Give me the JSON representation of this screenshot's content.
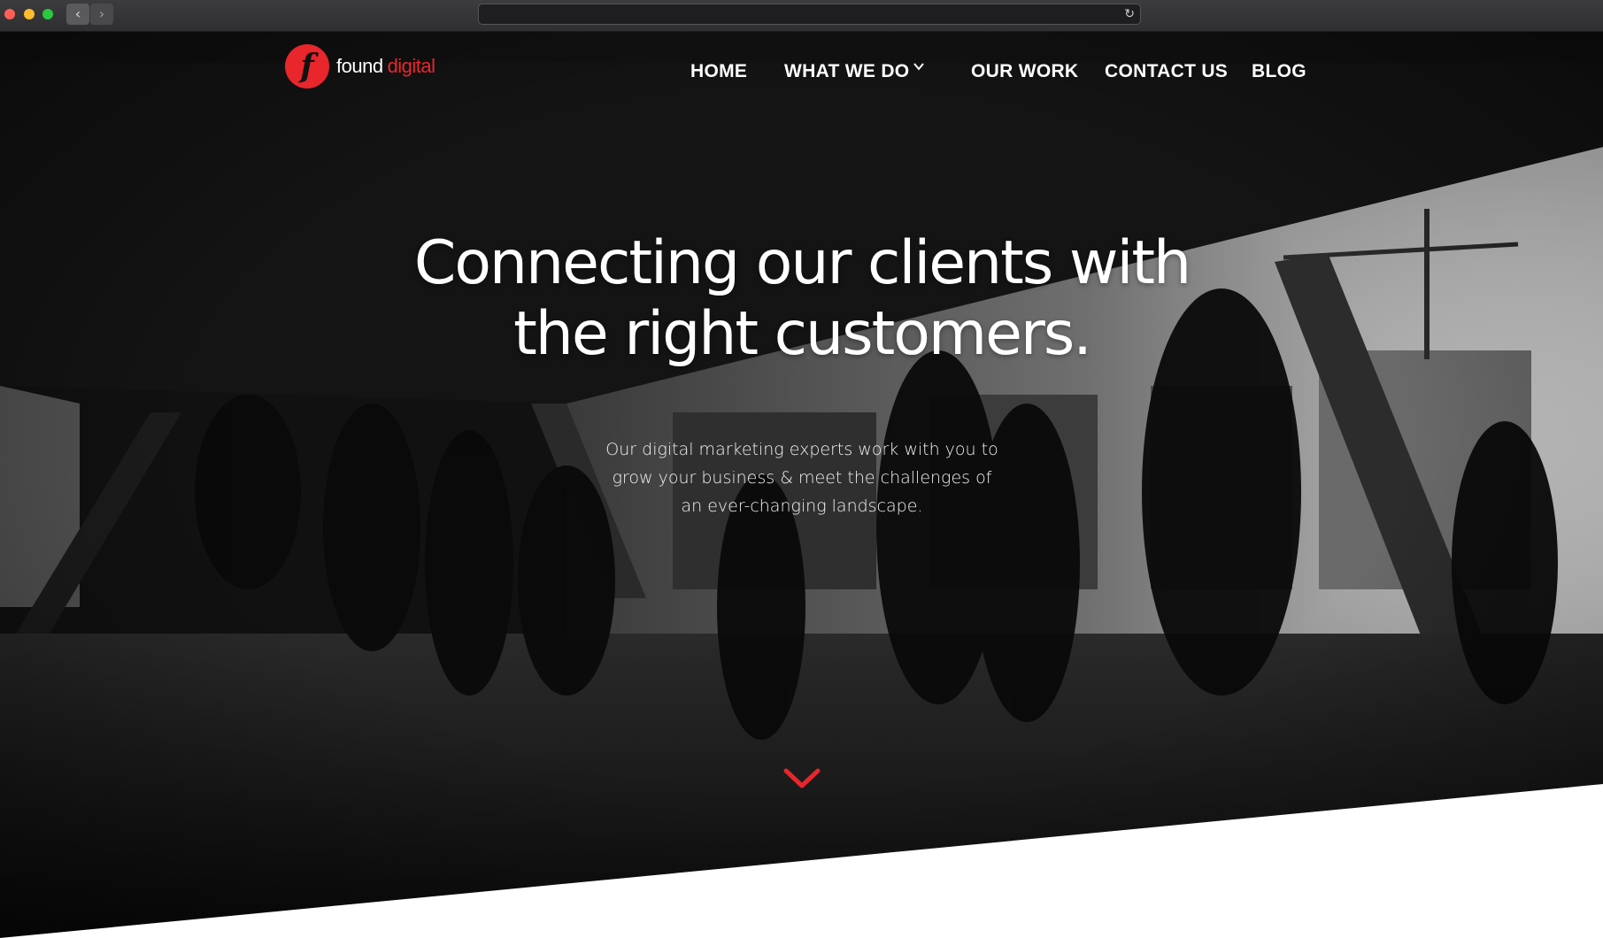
{
  "browser": {
    "back_glyph": "‹",
    "forward_glyph": "›",
    "reload_glyph": "↻",
    "icons": [
      "close-dot",
      "minimize-dot",
      "maximize-dot",
      "back-arrow-icon",
      "forward-arrow-icon",
      "reload-icon"
    ]
  },
  "brand": {
    "logo_letter": "f",
    "name_part1": "found",
    "name_part2": "digital",
    "accent_color": "#e8262c"
  },
  "nav": {
    "home": "HOME",
    "what_we_do": "WHAT WE DO",
    "our_work": "OUR WORK",
    "contact_us": "CONTACT US",
    "blog": "BLOG"
  },
  "hero": {
    "headline_line1": "Connecting our clients with",
    "headline_line2": "the right customers.",
    "sub_line1": "Our digital marketing experts work with you to",
    "sub_line2": "grow your business & meet the challenges of",
    "sub_line3": "an ever-changing landscape.",
    "scroll_icon": "chevron-down-icon"
  }
}
